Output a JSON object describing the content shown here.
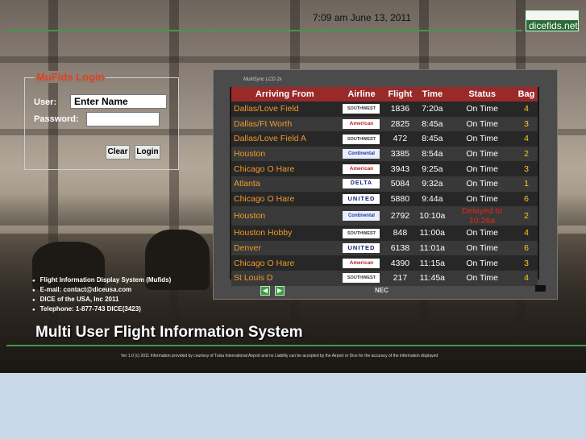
{
  "header": {
    "datetime": "7:09 am June 13, 2011",
    "logo_text": "dicefids.net"
  },
  "login": {
    "legend": "MuFids Login",
    "user_label": "User:",
    "user_value": "Enter Name",
    "password_label": "Password:",
    "password_value": "",
    "clear_label": "Clear",
    "login_label": "Login"
  },
  "monitor": {
    "model_label": "MultiSync LCD 2x",
    "brand": "NEC",
    "prev_icon": "prev-arrow-icon",
    "next_icon": "next-arrow-icon"
  },
  "board": {
    "columns": [
      "Arriving From",
      "Airline",
      "Flight",
      "Time",
      "Status",
      "Bag"
    ],
    "rows": [
      {
        "city": "Dallas/Love Field",
        "airline": "SOUTHWEST AIRLINES",
        "airline_code": "sw",
        "flight": "1836",
        "time": "7:20a",
        "status": "On Time",
        "bag": "4"
      },
      {
        "city": "Dallas/Ft Worth",
        "airline": "American Airlines",
        "airline_code": "aa",
        "flight": "2825",
        "time": "8:45a",
        "status": "On Time",
        "bag": "3"
      },
      {
        "city": "Dallas/Love Field A",
        "airline": "SOUTHWEST AIRLINES",
        "airline_code": "sw",
        "flight": "472",
        "time": "8:45a",
        "status": "On Time",
        "bag": "4"
      },
      {
        "city": "Houston",
        "airline": "Continental Express",
        "airline_code": "co",
        "flight": "3385",
        "time": "8:54a",
        "status": "On Time",
        "bag": "2"
      },
      {
        "city": "Chicago O Hare",
        "airline": "American Airlines",
        "airline_code": "aa",
        "flight": "3943",
        "time": "9:25a",
        "status": "On Time",
        "bag": "3"
      },
      {
        "city": "Atlanta",
        "airline": "DELTA",
        "airline_code": "dl",
        "flight": "5084",
        "time": "9:32a",
        "status": "On Time",
        "bag": "1"
      },
      {
        "city": "Chicago O Hare",
        "airline": "UNITED",
        "airline_code": "ua",
        "flight": "5880",
        "time": "9:44a",
        "status": "On Time",
        "bag": "6"
      },
      {
        "city": "Houston",
        "airline": "Continental Express",
        "airline_code": "co",
        "flight": "2792",
        "time": "10:10a",
        "status": "Delayed to 10:26a",
        "bag": "2"
      },
      {
        "city": "Houston Hobby",
        "airline": "SOUTHWEST AIRLINES",
        "airline_code": "sw",
        "flight": "848",
        "time": "11:00a",
        "status": "On Time",
        "bag": "4"
      },
      {
        "city": "Denver",
        "airline": "UNITED",
        "airline_code": "ua",
        "flight": "6138",
        "time": "11:01a",
        "status": "On Time",
        "bag": "6"
      },
      {
        "city": "Chicago O Hare",
        "airline": "American Airlines",
        "airline_code": "aa",
        "flight": "4390",
        "time": "11:15a",
        "status": "On Time",
        "bag": "3"
      },
      {
        "city": "St Louis D",
        "airline": "SOUTHWEST AIRLINES",
        "airline_code": "sw",
        "flight": "217",
        "time": "11:45a",
        "status": "On Time",
        "bag": "4"
      }
    ]
  },
  "info": [
    "Flight Information Display System (Mufids)",
    "E-mail: contact@diceusa.com",
    "DICE of the USA, Inc 2011",
    "Telephone: 1-877-743 DICE(3423)"
  ],
  "headline": "Multi User Flight Information System",
  "footnote": "Ver 1.0 (c) 2011 Information provided by courtesy of Tulsa International Airport and no Liability can be accepted by the Airport or Dice for the accuracy of the information displayed",
  "colors": {
    "accent_green": "#3f9a4a",
    "login_title": "#e3411f",
    "city": "#f29a2a",
    "bag": "#f5d020",
    "delayed": "#e02a1a",
    "header_row": "#9a2a2a"
  }
}
